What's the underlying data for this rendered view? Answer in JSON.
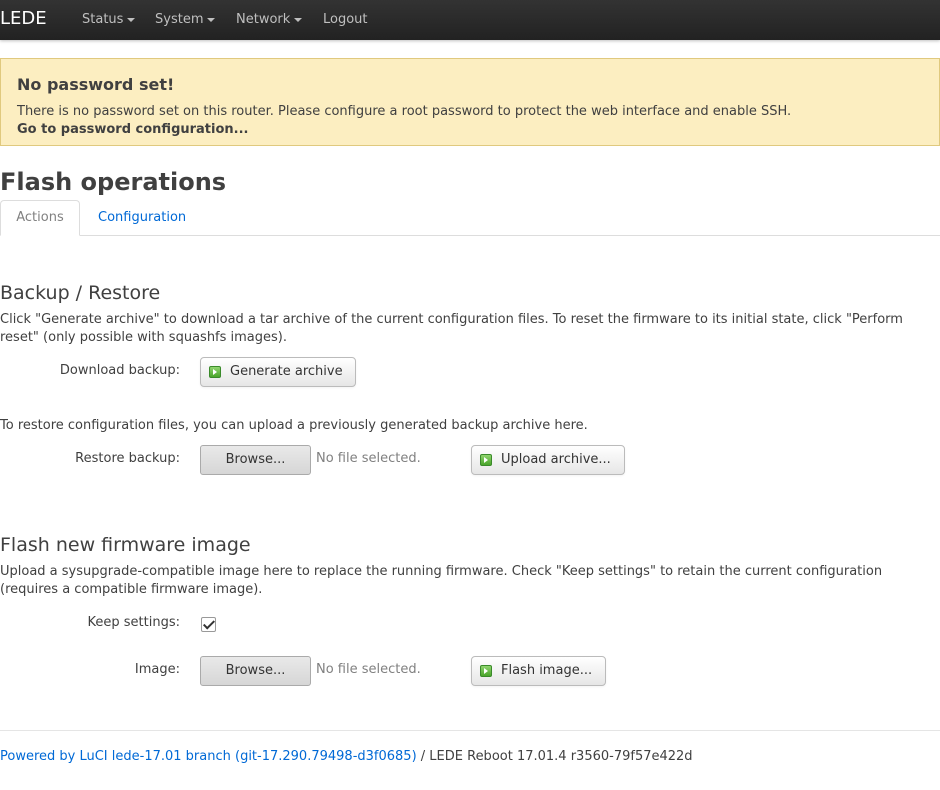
{
  "nav": {
    "brand": "LEDE",
    "items": [
      {
        "label": "Status",
        "dropdown": true
      },
      {
        "label": "System",
        "dropdown": true
      },
      {
        "label": "Network",
        "dropdown": true
      },
      {
        "label": "Logout",
        "dropdown": false
      }
    ]
  },
  "alert": {
    "title": "No password set!",
    "text": "There is no password set on this router. Please configure a root password to protect the web interface and enable SSH.",
    "link": "Go to password configuration..."
  },
  "page": {
    "title": "Flash operations",
    "tabs": [
      {
        "label": "Actions",
        "active": true
      },
      {
        "label": "Configuration",
        "active": false
      }
    ]
  },
  "backup": {
    "title": "Backup / Restore",
    "description": "Click \"Generate archive\" to download a tar archive of the current configuration files. To reset the firmware to its initial state, click \"Perform reset\" (only possible with squashfs images).",
    "download_label": "Download backup:",
    "generate_button": "Generate archive",
    "restore_description": "To restore configuration files, you can upload a previously generated backup archive here.",
    "restore_label": "Restore backup:",
    "browse_button": "Browse...",
    "no_file": "No file selected.",
    "upload_button": "Upload archive..."
  },
  "flash": {
    "title": "Flash new firmware image",
    "description": "Upload a sysupgrade-compatible image here to replace the running firmware. Check \"Keep settings\" to retain the current configuration (requires a compatible firmware image).",
    "keep_label": "Keep settings:",
    "keep_checked": true,
    "image_label": "Image:",
    "browse_button": "Browse...",
    "no_file": "No file selected.",
    "flash_button": "Flash image..."
  },
  "footer": {
    "link": "Powered by LuCI lede-17.01 branch (git-17.290.79498-d3f0685)",
    "text": " / LEDE Reboot 17.01.4 r3560-79f57e422d"
  }
}
